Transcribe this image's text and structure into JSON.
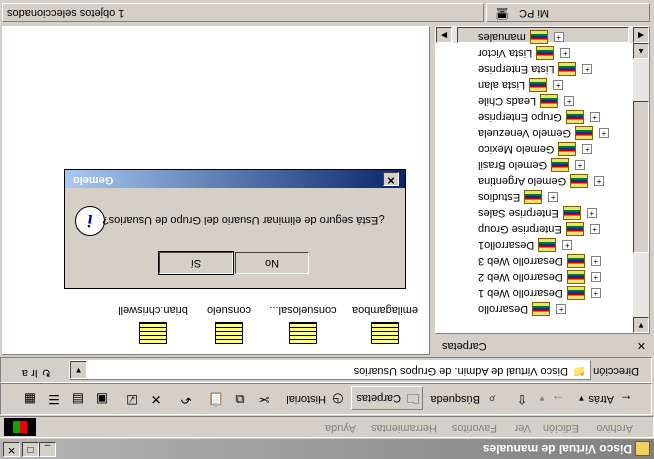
{
  "window": {
    "title": "Disco Virtual de manuales",
    "minimize": "_",
    "maximize": "□",
    "close": "✕"
  },
  "menu": [
    "Archivo",
    "Edición",
    "Ver",
    "Favoritos",
    "Herramientas",
    "Ayuda"
  ],
  "toolbar": {
    "back": "Atrás",
    "search": "Búsqueda",
    "folders": "Carpetas",
    "history": "Historial"
  },
  "address": {
    "label": "Dirección",
    "value": "Disco Virtual de Admin. de Grupos Usuarios",
    "go": "Ir a"
  },
  "folders_panel": {
    "title": "Carpetas",
    "close": "✕",
    "items": [
      "Desarrollo",
      "Desarrollo Web 1",
      "Desarrollo Web 2",
      "Desarrollo Web 3",
      "Desarrollo1",
      "Enterprise Group",
      "Enterprise Sales",
      "Estudios",
      "Gemelo Argentina",
      "Gemelo Brasil",
      "Gemelo Mexico",
      "Gemelo Venezuela",
      "Grupo Enterprise",
      "Leads Chile",
      "Lista alan",
      "Lista Enterprise",
      "Lista Victor",
      "manuales"
    ]
  },
  "files": [
    "brian.chriswell",
    "consuelo",
    "consuelosal...",
    "emilagamboa"
  ],
  "dialog": {
    "title": "Gemelo",
    "message": "¿Está seguro de eliminar Usuario del Grupo de Usuarios?",
    "yes": "Sí",
    "no": "No",
    "close": "✕"
  },
  "status": {
    "left": "1 objetos seleccionados",
    "right": "Mi PC"
  }
}
